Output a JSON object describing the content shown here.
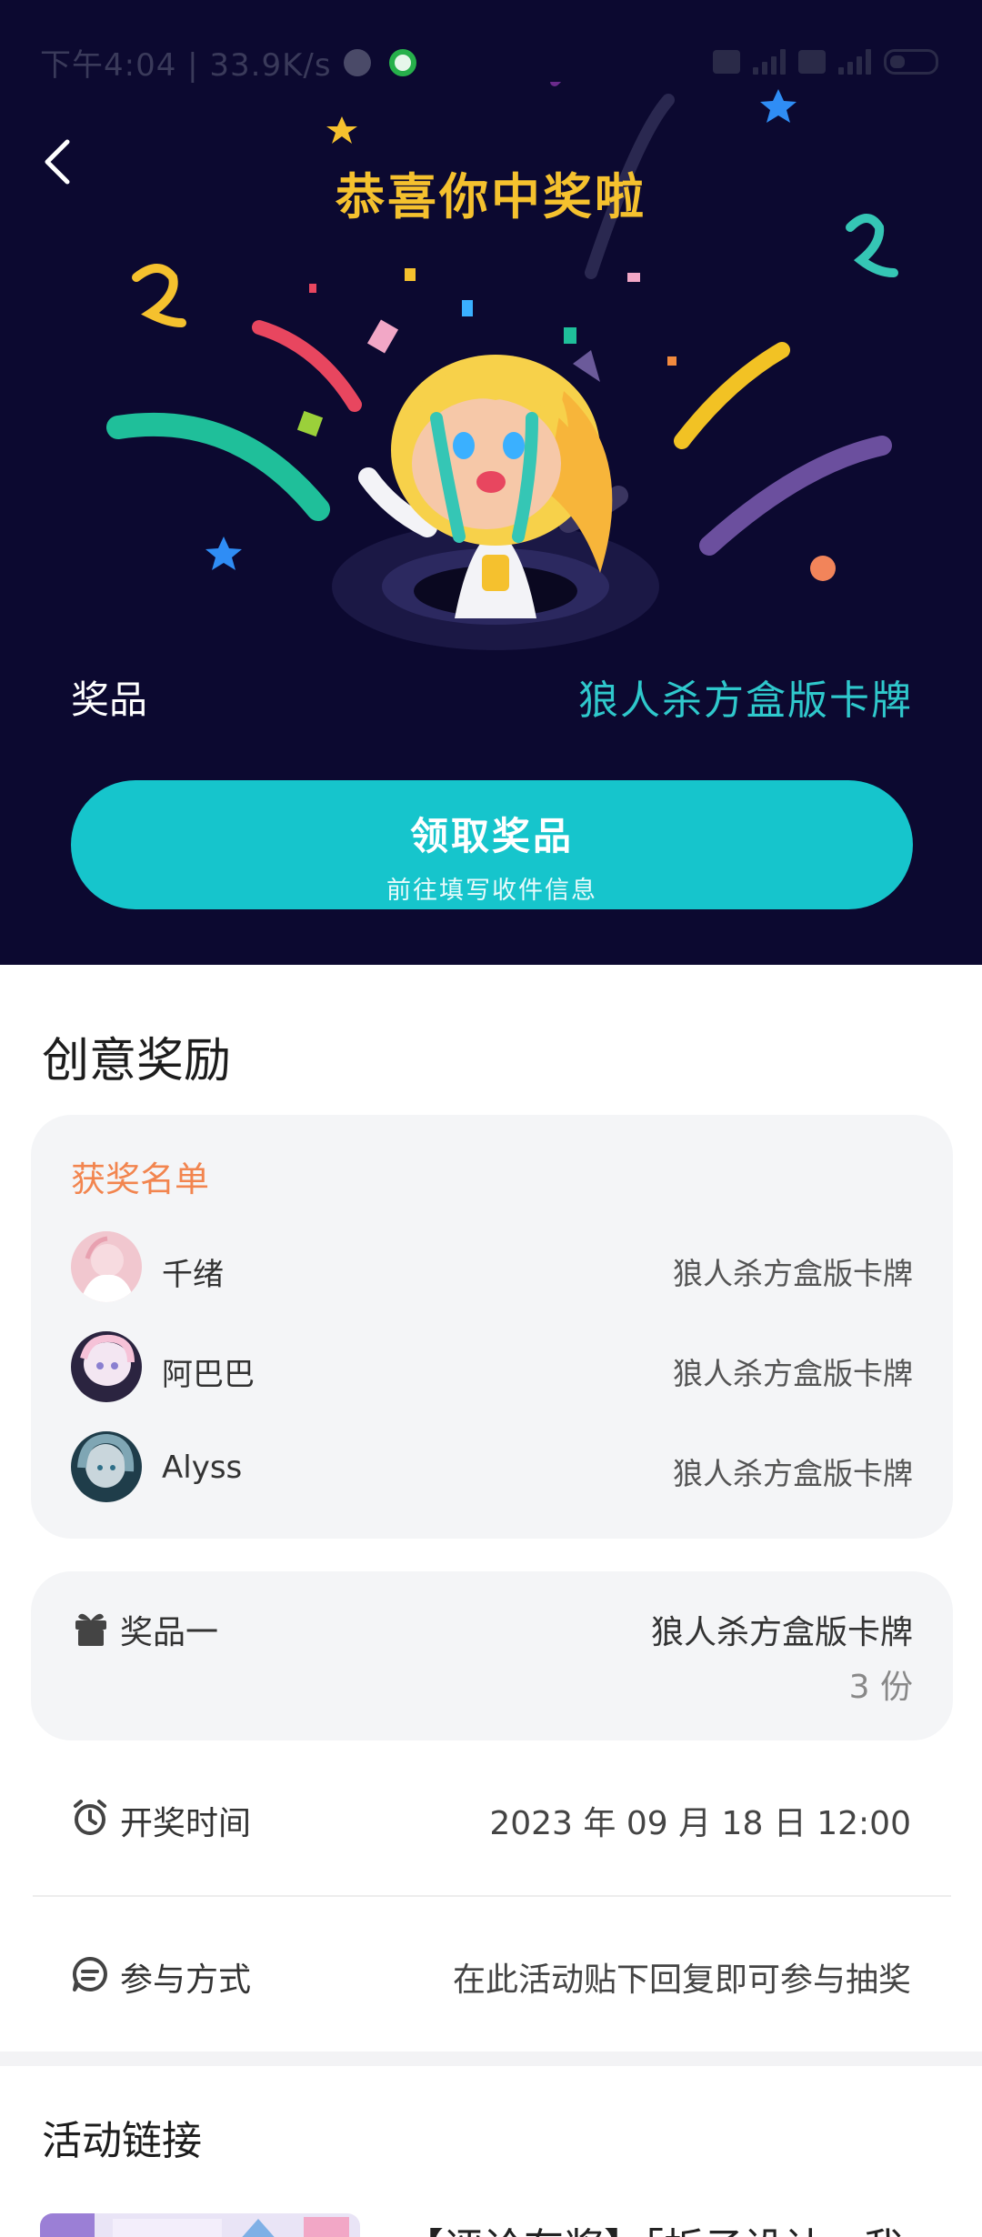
{
  "status_bar": {
    "time": "下午4:04 | 33.9K/s"
  },
  "header": {
    "title": "恭喜你中奖啦"
  },
  "prize": {
    "label": "奖品",
    "name": "狼人杀方盒版卡牌"
  },
  "claim_button": {
    "label": "领取奖品",
    "sublabel": "前往填写收件信息"
  },
  "reward_section": {
    "title": "创意奖励",
    "winners_title": "获奖名单",
    "winners": [
      {
        "name": "千绪",
        "prize": "狼人杀方盒版卡牌"
      },
      {
        "name": "阿巴巴",
        "prize": "狼人杀方盒版卡牌"
      },
      {
        "name": "Alyss",
        "prize": "狼人杀方盒版卡牌"
      }
    ]
  },
  "prize_item": {
    "label": "奖品一",
    "name": "狼人杀方盒版卡牌",
    "quantity": "3 份"
  },
  "draw_time": {
    "label": "开奖时间",
    "value": "2023 年 09 月 18 日 12:00"
  },
  "participation": {
    "label": "参与方式",
    "value": "在此活动贴下回复即可参与抽奖"
  },
  "activity_link": {
    "title": "活动链接",
    "link_title": "【评论有奖】「折子设计」我"
  },
  "colors": {
    "hero_bg": "#0c0930",
    "accent": "#16c5cc",
    "title_gold": "#f5c12e",
    "winners_orange": "#f2854f"
  }
}
